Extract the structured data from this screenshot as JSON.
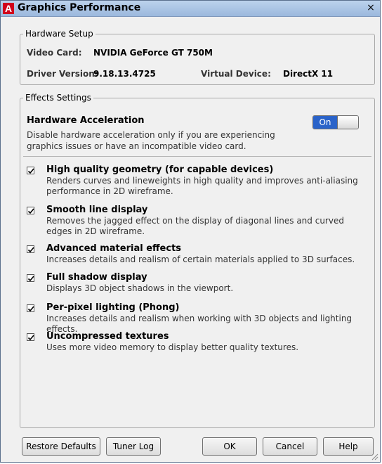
{
  "window": {
    "title": "Graphics Performance",
    "app_icon_letter": "A",
    "close_glyph": "×"
  },
  "hardware": {
    "legend": "Hardware Setup",
    "video_card_label": "Video Card:",
    "video_card_value": "NVIDIA GeForce GT 750M",
    "driver_label": "Driver Version:",
    "driver_value": "9.18.13.4725",
    "device_label": "Virtual Device:",
    "device_value": "DirectX 11"
  },
  "effects": {
    "legend": "Effects Settings",
    "hardware_acceleration": {
      "title": "Hardware Acceleration",
      "description": "Disable hardware acceleration only if you are experiencing graphics issues or have an incompatible video card.",
      "toggle_label": "On",
      "enabled": true
    },
    "options": [
      {
        "title": "High quality geometry (for capable devices)",
        "description": "Renders curves and lineweights in high quality and improves anti-aliasing performance in 2D wireframe.",
        "checked": true
      },
      {
        "title": "Smooth line display",
        "description": "Removes the jagged effect on the display of diagonal lines and curved edges in 2D wireframe.",
        "checked": true
      },
      {
        "title": "Advanced material effects",
        "description": "Increases details and realism of certain materials applied to 3D surfaces.",
        "checked": true
      },
      {
        "title": "Full shadow display",
        "description": "Displays 3D object shadows in the viewport.",
        "checked": true
      },
      {
        "title": "Per-pixel lighting (Phong)",
        "description": "Increases details and realism when working with 3D objects and lighting effects.",
        "checked": true
      },
      {
        "title": "Uncompressed textures",
        "description": "Uses more video memory to display better quality textures.",
        "checked": true
      }
    ]
  },
  "buttons": {
    "restore_defaults": "Restore Defaults",
    "tuner_log": "Tuner Log",
    "ok": "OK",
    "cancel": "Cancel",
    "help": "Help"
  },
  "colors": {
    "toggle_on": "#2a63c9",
    "titlebar": "#bcd2ec",
    "app_icon": "#d0021b"
  }
}
